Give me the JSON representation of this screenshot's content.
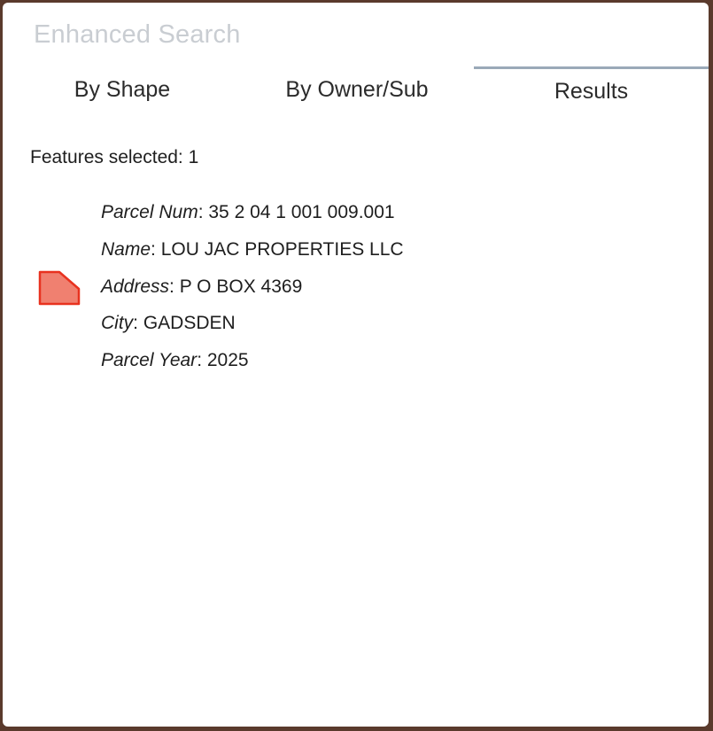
{
  "panel": {
    "title": "Enhanced Search"
  },
  "tabs": [
    {
      "label": "By Shape",
      "active": false
    },
    {
      "label": "By Owner/Sub",
      "active": false
    },
    {
      "label": "Results",
      "active": true
    }
  ],
  "results": {
    "summary": "Features selected: 1",
    "items": [
      {
        "icon": "parcel-polygon-icon",
        "icon_fill": "#f08070",
        "icon_stroke": "#e8321f",
        "fields": [
          {
            "key": "Parcel Num",
            "sep": ": ",
            "value": "35 2 04 1 001 009.001"
          },
          {
            "key": "Name",
            "sep": ": ",
            "value": "LOU JAC PROPERTIES LLC"
          },
          {
            "key": "Address",
            "sep": ": ",
            "value": "P O BOX 4369"
          },
          {
            "key": "City",
            "sep": ": ",
            "value": "GADSDEN"
          },
          {
            "key": "Parcel Year",
            "sep": ": ",
            "value": "2025"
          }
        ]
      }
    ]
  },
  "colors": {
    "title": "#c9cdd2",
    "active_tab_indicator": "#9aa9b8"
  }
}
